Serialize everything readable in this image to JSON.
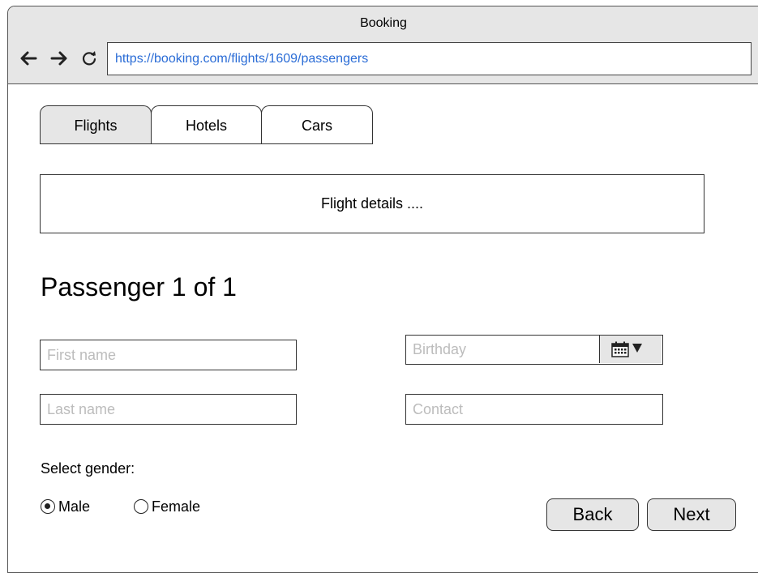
{
  "window": {
    "title": "Booking",
    "url": "https://booking.com/flights/1609/passengers"
  },
  "nav": {
    "back_icon": "arrow-left-icon",
    "forward_icon": "arrow-right-icon",
    "reload_icon": "reload-icon"
  },
  "tabs": [
    {
      "label": "Flights",
      "active": true
    },
    {
      "label": "Hotels",
      "active": false
    },
    {
      "label": "Cars",
      "active": false
    }
  ],
  "details": {
    "text": "Flight details ...."
  },
  "form": {
    "title": "Passenger 1 of 1",
    "first_name_placeholder": "First name",
    "last_name_placeholder": "Last name",
    "birthday_placeholder": "Birthday",
    "contact_placeholder": "Contact",
    "calendar_icon": "calendar-icon",
    "gender_label": "Select gender:",
    "gender_options": [
      {
        "label": "Male",
        "checked": true
      },
      {
        "label": "Female",
        "checked": false
      }
    ],
    "back_label": "Back",
    "next_label": "Next"
  },
  "colors": {
    "chrome_bg": "#e6e6e6",
    "url_text": "#2a6cd6",
    "placeholder": "#bcbcbc"
  }
}
